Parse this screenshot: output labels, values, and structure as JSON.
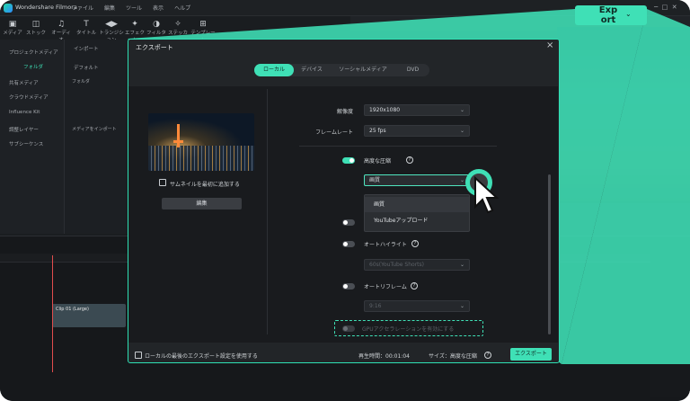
{
  "app": {
    "title": "Wondershare Filmora",
    "menu": [
      "ファイル",
      "編集",
      "ツール",
      "表示",
      "ヘルプ"
    ]
  },
  "toolbar": {
    "items": [
      {
        "label": "メディア",
        "icon": "media-icon"
      },
      {
        "label": "ストック",
        "icon": "stock-icon"
      },
      {
        "label": "オーディオ",
        "icon": "music-icon"
      },
      {
        "label": "タイトル",
        "icon": "title-icon"
      },
      {
        "label": "トランジション",
        "icon": "transition-icon"
      },
      {
        "label": "エフェクト",
        "icon": "effects-icon"
      },
      {
        "label": "フィルター",
        "icon": "filter-icon"
      },
      {
        "label": "ステッカー",
        "icon": "sticker-icon"
      },
      {
        "label": "テンプレート",
        "icon": "template-icon"
      }
    ]
  },
  "left_panel": {
    "items": [
      "プロジェクトメディア",
      "フォルダ",
      "共有メディア",
      "クラウドメディア",
      "Influence Kit",
      "調整レイヤー",
      "サブシーケンス"
    ]
  },
  "media_browser": {
    "import_label": "インポート",
    "default_label": "デフォルト",
    "folder_label": "フォルダ",
    "import_media_label": "メディアをインポート"
  },
  "clip": {
    "label": "Clip 01 (Large)"
  },
  "export_dialog": {
    "title": "エクスポート",
    "tabs": [
      "ローカル",
      "デバイス",
      "ソーシャルメディア",
      "DVD"
    ],
    "active_tab": 0,
    "thumbnail_checkbox_label": "サムネイルを最初に追加する",
    "edit_button": "編集",
    "resolution_label": "解像度",
    "resolution_value": "1920x1080",
    "framerate_label": "フレームレート",
    "framerate_value": "25 fps",
    "advanced_compression_label": "高度な圧縮",
    "quality_select_value": "画質",
    "dropdown_options": [
      "画質",
      "YouTubeアップロード"
    ],
    "auto_highlight_label": "オートハイライト",
    "auto_highlight_value": "60s(YouTube Shorts)",
    "auto_reframe_label": "オートリフレーム",
    "auto_reframe_value": "9:16",
    "gpu_label": "GPUアクセラレーションを有効にする",
    "footer_checkbox_label": "ローカルの最後のエクスポート設定を使用する",
    "duration_text": "再生時間：00:01:04",
    "size_text": "サイズ：高度な圧縮",
    "export_button": "エクスポート",
    "info_glyph": "?"
  },
  "callout": {
    "label": "Exp ort",
    "accent": "#3fe0b6"
  },
  "colors": {
    "accent": "#3fe0b6",
    "background": "#1a1d20",
    "dialog": "#222528"
  }
}
